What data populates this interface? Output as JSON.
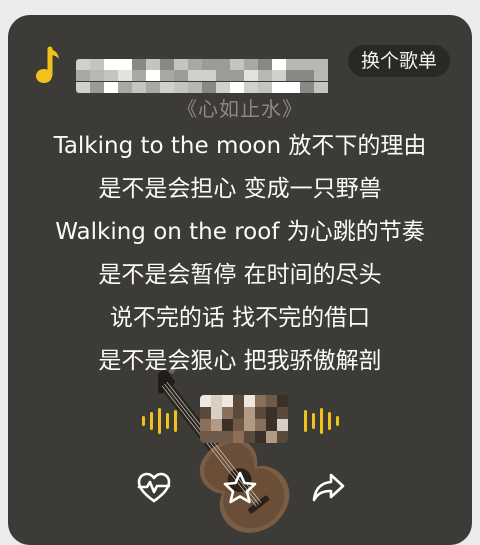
{
  "header": {
    "switch_playlist_label": "换个歌单"
  },
  "song": {
    "title": "《心如止水》",
    "lyrics": [
      "Talking to the moon 放不下的理由",
      "是不是会担心 变成一只野兽",
      "Walking on the roof 为心跳的节奏",
      "是不是会暂停 在时间的尽头",
      "说不完的话 找不完的借口",
      "是不是会狠心 把我骄傲解剖"
    ]
  },
  "colors": {
    "card_background": "#3d3b37",
    "accent_yellow": "#f2c21b",
    "lyric_text": "#fbfaf7",
    "song_title_text": "#8c8980"
  },
  "icons": {
    "music_note": "music-note-icon",
    "heartbeat": "heartbeat-icon",
    "star": "star-icon",
    "share": "share-icon"
  }
}
